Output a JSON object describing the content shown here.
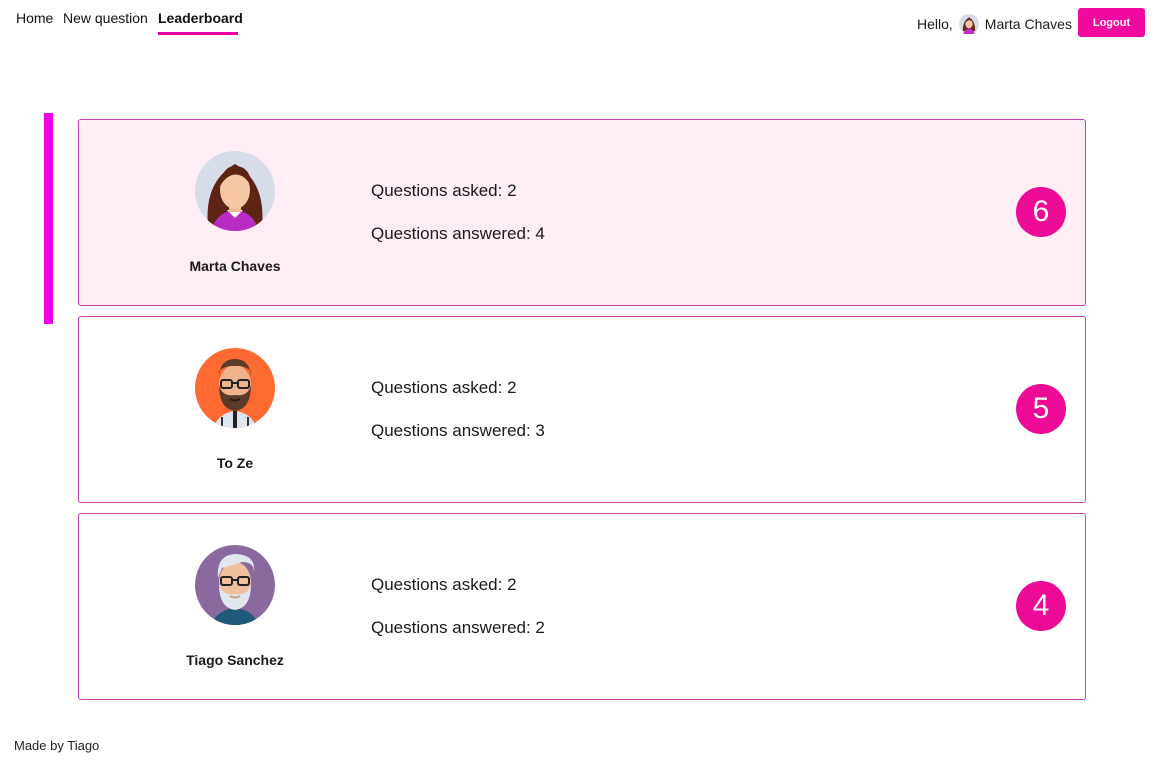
{
  "nav": {
    "links": [
      {
        "label": "Home"
      },
      {
        "label": "New question"
      },
      {
        "label": "Leaderboard",
        "active": true
      }
    ],
    "greeting": "Hello,",
    "user_name": "Marta Chaves",
    "logout_label": "Logout"
  },
  "leaderboard": [
    {
      "name": "Marta Chaves",
      "asked": "Questions asked: 2",
      "answered": "Questions answered: 4",
      "score": "6",
      "avatar": "woman-avatar-icon"
    },
    {
      "name": "To Ze",
      "asked": "Questions asked: 2",
      "answered": "Questions answered: 3",
      "score": "5",
      "avatar": "bearded-man-avatar-icon"
    },
    {
      "name": "Tiago Sanchez",
      "asked": "Questions asked: 2",
      "answered": "Questions answered: 2",
      "score": "4",
      "avatar": "old-man-avatar-icon"
    }
  ],
  "footer": "Made by Tiago",
  "colors": {
    "accent": "#f0089f",
    "highlight": "#ffeef5",
    "border": "#c43cb8"
  }
}
